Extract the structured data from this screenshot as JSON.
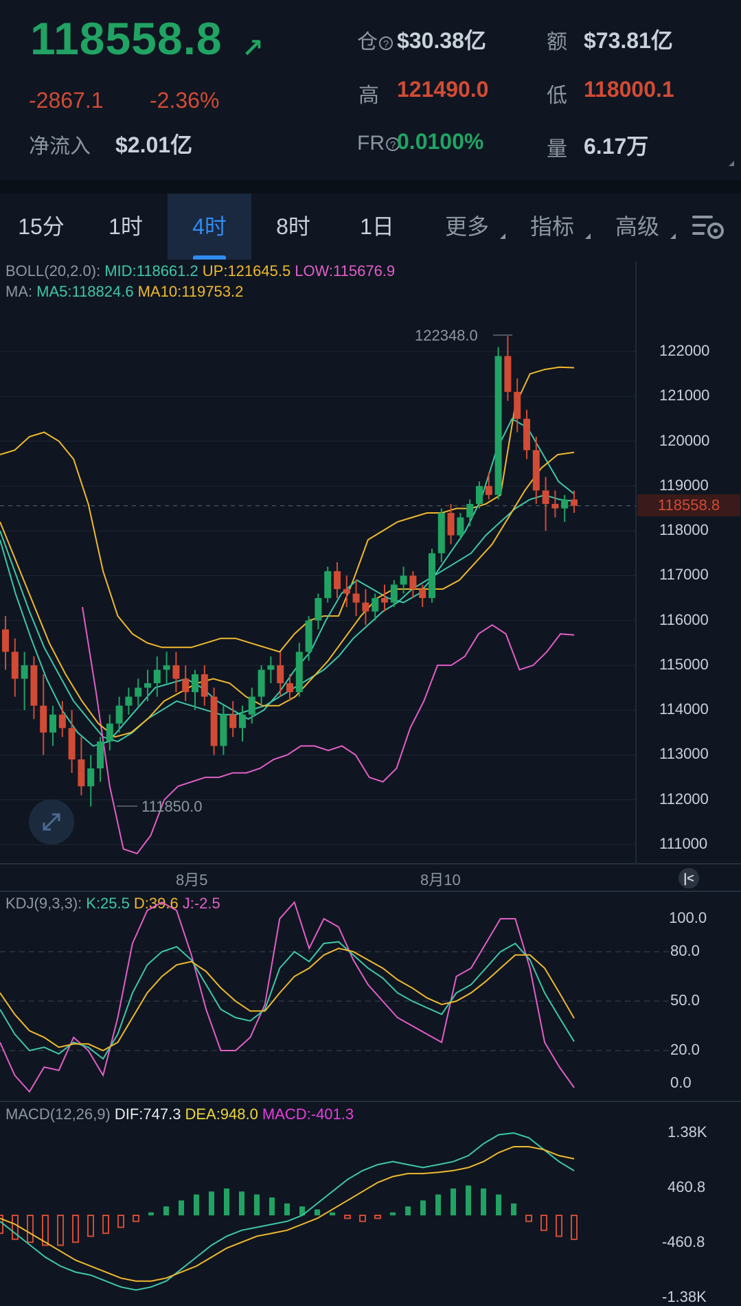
{
  "header": {
    "price": "118558.8",
    "change_abs": "-2867.1",
    "change_pct": "-2.36%",
    "inflow_label": "净流入",
    "inflow_value": "$2.01亿",
    "position_label": "仓",
    "position_value": "$30.38亿",
    "amount_label": "额",
    "amount_value": "$73.81亿",
    "high_label": "高",
    "high_value": "121490.0",
    "low_label": "低",
    "low_value": "118000.1",
    "fr_label": "FR",
    "fr_value": "0.0100%",
    "volume_label": "量",
    "volume_value": "6.17万",
    "up_color": "#21a363",
    "down_color": "#d24b35"
  },
  "tabs": [
    {
      "label": "15分",
      "active": false
    },
    {
      "label": "1时",
      "active": false
    },
    {
      "label": "4时",
      "active": true
    },
    {
      "label": "8时",
      "active": false
    },
    {
      "label": "1日",
      "active": false
    },
    {
      "label": "更多",
      "active": false
    },
    {
      "label": "指标",
      "active": false
    },
    {
      "label": "高级",
      "active": false
    }
  ],
  "indicators": {
    "boll_name": "BOLL(20,2.0):",
    "boll_mid": "MID:118661.2",
    "boll_up": "UP:121645.5",
    "boll_low": "LOW:115676.9",
    "ma_name": "MA:",
    "ma5": "MA5:118824.6",
    "ma10": "MA10:119753.2",
    "kdj_name": "KDJ(9,3,3):",
    "kdj_k": "K:25.5",
    "kdj_d": "D:39.6",
    "kdj_j": "J:-2.5",
    "macd_name": "MACD(12,26,9)",
    "macd_dif": "DIF:747.3",
    "macd_dea": "DEA:948.0",
    "macd_macd": "MACD:-401.3"
  },
  "main_chart": {
    "y_ticks": [
      "122000",
      "121000",
      "120000",
      "119000",
      "118000",
      "117000",
      "116000",
      "115000",
      "114000",
      "113000",
      "112000",
      "111000"
    ],
    "current_price_label": "118558.8",
    "max_label": "122348.0",
    "min_label": "111850.0",
    "x_labels": [
      "8月5",
      "8月10"
    ]
  },
  "kdj_chart": {
    "y_ticks": [
      "100.0",
      "80.0",
      "50.0",
      "20.0",
      "0.0"
    ]
  },
  "macd_chart": {
    "y_ticks": [
      "1.38K",
      "460.8",
      "-460.8",
      "-1.38K"
    ]
  },
  "chart_data": {
    "type": "line",
    "title": "",
    "price_axis": {
      "ylim": [
        110800,
        122700
      ]
    },
    "candles_ohlc": [
      [
        115800,
        116100,
        114900,
        115300
      ],
      [
        115300,
        115600,
        114300,
        114700
      ],
      [
        114700,
        115300,
        114000,
        115000
      ],
      [
        115000,
        115200,
        113800,
        114100
      ],
      [
        114100,
        114800,
        113000,
        113500
      ],
      [
        113500,
        114100,
        113200,
        113900
      ],
      [
        113900,
        114200,
        113400,
        113600
      ],
      [
        113600,
        114000,
        112600,
        112900
      ],
      [
        112900,
        113400,
        112100,
        112300
      ],
      [
        112300,
        113000,
        111850,
        112700
      ],
      [
        112700,
        113400,
        112400,
        113300
      ],
      [
        113300,
        113900,
        113100,
        113700
      ],
      [
        113700,
        114300,
        113500,
        114100
      ],
      [
        114100,
        114500,
        113900,
        114300
      ],
      [
        114300,
        114700,
        114100,
        114500
      ],
      [
        114500,
        114900,
        114200,
        114600
      ],
      [
        114600,
        115200,
        114300,
        114900
      ],
      [
        114900,
        115300,
        114600,
        115000
      ],
      [
        115000,
        115300,
        114400,
        114700
      ],
      [
        114700,
        115000,
        114200,
        114400
      ],
      [
        114400,
        114900,
        114000,
        114800
      ],
      [
        114800,
        115000,
        114100,
        114300
      ],
      [
        114300,
        114500,
        113000,
        113200
      ],
      [
        113200,
        114100,
        113000,
        113900
      ],
      [
        113900,
        114200,
        113400,
        113600
      ],
      [
        113600,
        114100,
        113300,
        113900
      ],
      [
        113900,
        114500,
        113700,
        114300
      ],
      [
        114300,
        115000,
        114100,
        114900
      ],
      [
        114900,
        115200,
        114600,
        115000
      ],
      [
        115000,
        115300,
        114300,
        114600
      ],
      [
        114600,
        114800,
        114200,
        114400
      ],
      [
        114400,
        115500,
        114300,
        115300
      ],
      [
        115300,
        116100,
        115100,
        116000
      ],
      [
        116000,
        116600,
        115800,
        116500
      ],
      [
        116500,
        117200,
        116400,
        117100
      ],
      [
        117100,
        117300,
        116500,
        116700
      ],
      [
        116700,
        117000,
        116300,
        116600
      ],
      [
        116600,
        116900,
        116100,
        116400
      ],
      [
        116400,
        116700,
        115900,
        116200
      ],
      [
        116200,
        116600,
        116000,
        116500
      ],
      [
        116500,
        116800,
        116200,
        116400
      ],
      [
        116400,
        116900,
        116300,
        116800
      ],
      [
        116800,
        117200,
        116600,
        117000
      ],
      [
        117000,
        117100,
        116500,
        116700
      ],
      [
        116700,
        116800,
        116300,
        116500
      ],
      [
        116500,
        117600,
        116400,
        117500
      ],
      [
        117500,
        118500,
        117300,
        118400
      ],
      [
        118400,
        118600,
        117700,
        117900
      ],
      [
        117900,
        118400,
        117800,
        118300
      ],
      [
        118300,
        118700,
        118100,
        118600
      ],
      [
        118600,
        119100,
        118500,
        119000
      ],
      [
        119000,
        119300,
        118700,
        118800
      ],
      [
        118800,
        122100,
        118700,
        121900
      ],
      [
        121900,
        122348,
        120900,
        121100
      ],
      [
        121100,
        121400,
        120200,
        120500
      ],
      [
        120500,
        120700,
        119600,
        119800
      ],
      [
        119800,
        120100,
        118600,
        118900
      ],
      [
        118900,
        119200,
        118000,
        118600
      ],
      [
        118600,
        118900,
        118300,
        118500
      ],
      [
        118500,
        118800,
        118200,
        118700
      ],
      [
        118700,
        118900,
        118400,
        118558.8
      ]
    ],
    "boll_up": [
      119700,
      119800,
      120100,
      120200,
      120000,
      119600,
      118600,
      117100,
      116100,
      115700,
      115500,
      115400,
      115400,
      115400,
      115500,
      115600,
      115600,
      115500,
      115400,
      115300,
      115700,
      116000,
      116100,
      116100,
      116900,
      117800,
      118000,
      118200,
      118300,
      118400,
      118400,
      118500,
      118500,
      118600,
      118800,
      120800,
      121500,
      121600,
      121650,
      121640
    ],
    "boll_mid": [
      118000,
      117100,
      116200,
      115400,
      114800,
      114200,
      113800,
      113400,
      113300,
      113500,
      113800,
      114000,
      114200,
      114100,
      114000,
      113900,
      113900,
      114000,
      114100,
      114300,
      114500,
      114700,
      114900,
      115200,
      115600,
      115900,
      116200,
      116400,
      116700,
      116900,
      117100,
      117300,
      117500,
      117900,
      118200,
      118500,
      118700,
      118800,
      118700,
      118661
    ],
    "boll_low": [
      116300,
      114400,
      112300,
      110900,
      110800,
      111200,
      112000,
      112300,
      112400,
      112500,
      112500,
      112600,
      112600,
      112700,
      112900,
      113000,
      113200,
      113200,
      113100,
      113200,
      113000,
      112500,
      112400,
      112700,
      113600,
      114200,
      115000,
      115000,
      115200,
      115700,
      115900,
      115700,
      114900,
      115000,
      115300,
      115700,
      115677
    ],
    "ma5": [
      117800,
      116600,
      115600,
      114700,
      114000,
      113500,
      113200,
      113300,
      113700,
      114100,
      114500,
      114600,
      114700,
      114500,
      114200,
      114000,
      113800,
      114000,
      114400,
      114900,
      115300,
      116000,
      116600,
      116900,
      116700,
      116500,
      116400,
      116600,
      117000,
      117500,
      118000,
      118700,
      119800,
      120500,
      120300,
      119700,
      119100,
      118824
    ],
    "ma10": [
      118200,
      117300,
      116400,
      115500,
      114800,
      114200,
      113700,
      113400,
      113500,
      113800,
      114200,
      114400,
      114600,
      114700,
      114600,
      114300,
      114100,
      114100,
      114300,
      114700,
      115100,
      115600,
      116100,
      116500,
      116700,
      116700,
      116700,
      116700,
      116900,
      117300,
      117700,
      118300,
      118900,
      119400,
      119700,
      119753
    ],
    "kdj": {
      "ylim": [
        0,
        100
      ],
      "k": [
        45,
        30,
        20,
        22,
        18,
        25,
        22,
        15,
        30,
        55,
        72,
        80,
        83,
        75,
        60,
        45,
        40,
        38,
        45,
        70,
        80,
        74,
        85,
        86,
        78,
        70,
        64,
        55,
        50,
        46,
        42,
        55,
        60,
        70,
        80,
        85,
        75,
        55,
        40,
        25.5
      ],
      "d": [
        55,
        42,
        32,
        28,
        22,
        24,
        24,
        20,
        25,
        40,
        55,
        65,
        72,
        74,
        68,
        58,
        50,
        44,
        44,
        55,
        65,
        70,
        78,
        82,
        80,
        75,
        70,
        63,
        58,
        52,
        48,
        50,
        55,
        62,
        70,
        78,
        78,
        70,
        55,
        39.6
      ],
      "j": [
        25,
        5,
        -5,
        10,
        8,
        28,
        20,
        5,
        40,
        85,
        105,
        110,
        105,
        78,
        45,
        20,
        20,
        28,
        48,
        100,
        110,
        82,
        100,
        95,
        75,
        60,
        50,
        40,
        35,
        30,
        25,
        65,
        70,
        85,
        100,
        100,
        70,
        25,
        10,
        -2.5
      ]
    },
    "macd": {
      "ylim": [
        -1380,
        1380
      ],
      "dif": [
        -100,
        -300,
        -500,
        -700,
        -850,
        -950,
        -1000,
        -1100,
        -1200,
        -1250,
        -1200,
        -1100,
        -900,
        -700,
        -500,
        -350,
        -250,
        -200,
        -150,
        -100,
        0,
        200,
        400,
        600,
        750,
        850,
        900,
        850,
        800,
        850,
        900,
        1000,
        1200,
        1350,
        1380,
        1300,
        1100,
        900,
        747
      ],
      "dea": [
        -50,
        -150,
        -300,
        -450,
        -600,
        -750,
        -850,
        -950,
        -1050,
        -1100,
        -1100,
        -1050,
        -950,
        -850,
        -700,
        -550,
        -450,
        -350,
        -300,
        -250,
        -150,
        -50,
        100,
        250,
        400,
        550,
        650,
        700,
        700,
        720,
        750,
        800,
        900,
        1050,
        1150,
        1150,
        1100,
        1000,
        948
      ],
      "hist": [
        -300,
        -400,
        -450,
        -500,
        -500,
        -450,
        -350,
        -300,
        -200,
        -100,
        50,
        150,
        250,
        350,
        400,
        450,
        400,
        350,
        300,
        200,
        150,
        100,
        50,
        -50,
        -100,
        -50,
        50,
        150,
        250,
        350,
        450,
        500,
        450,
        350,
        200,
        -100,
        -250,
        -350,
        -401
      ]
    }
  }
}
